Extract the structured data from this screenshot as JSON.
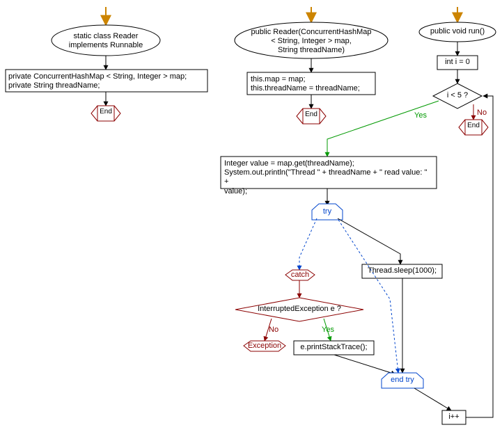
{
  "nodes": {
    "reader_class": "static class Reader\nimplements Runnable",
    "reader_fields": "private ConcurrentHashMap < String, Integer > map;\nprivate String threadName;",
    "end1": "End",
    "reader_ctor": "public Reader(ConcurrentHashMap\n< String, Integer > map,\nString threadName)",
    "ctor_body": "this.map = map;\nthis.threadName = threadName;",
    "end2": "End",
    "run_decl": "public void run()",
    "init_i": "int i = 0",
    "loop_cond": "i < 5 ?",
    "end3": "End",
    "loop_body": "Integer value = map.get(threadName);\nSystem.out.println(\"Thread \" + threadName + \" read value: \" +\nvalue);",
    "try_kw": "try",
    "sleep": "Thread.sleep(1000);",
    "catch_kw": "catch",
    "exc_cond": "InterruptedException e ?",
    "exc_throw": "Exception",
    "print_stack": "e.printStackTrace();",
    "end_try": "end try",
    "incr": "i++"
  },
  "labels": {
    "yes_loop": "Yes",
    "no_loop": "No",
    "yes_exc": "Yes",
    "no_exc": "No"
  }
}
